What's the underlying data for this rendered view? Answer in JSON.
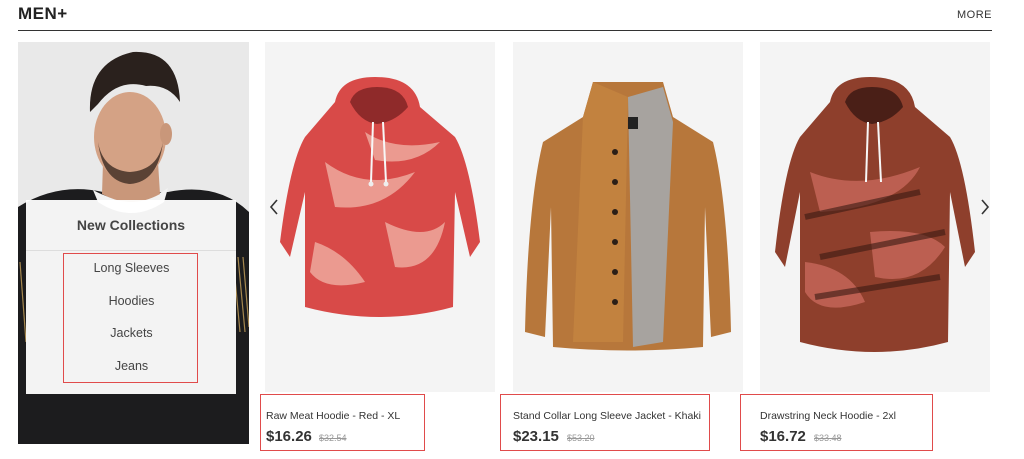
{
  "header": {
    "title": "MEN+",
    "more_label": "MORE"
  },
  "collections": {
    "title": "New Collections",
    "links": [
      "Long Sleeves",
      "Hoodies",
      "Jackets",
      "Jeans"
    ]
  },
  "products": [
    {
      "name": "Raw Meat Hoodie - Red - XL",
      "price": "$16.26",
      "old_price": "$32.54"
    },
    {
      "name": "Stand Collar Long Sleeve Jacket - Khaki",
      "price": "$23.15",
      "old_price": "$53.20"
    },
    {
      "name": "Drawstring Neck Hoodie - 2xl",
      "price": "$16.72",
      "old_price": "$33.48"
    }
  ],
  "icons": {
    "prev": "chevron-left-icon",
    "next": "chevron-right-icon"
  },
  "colors": {
    "accent_border": "#e04b4b",
    "header_rule": "#333333"
  }
}
